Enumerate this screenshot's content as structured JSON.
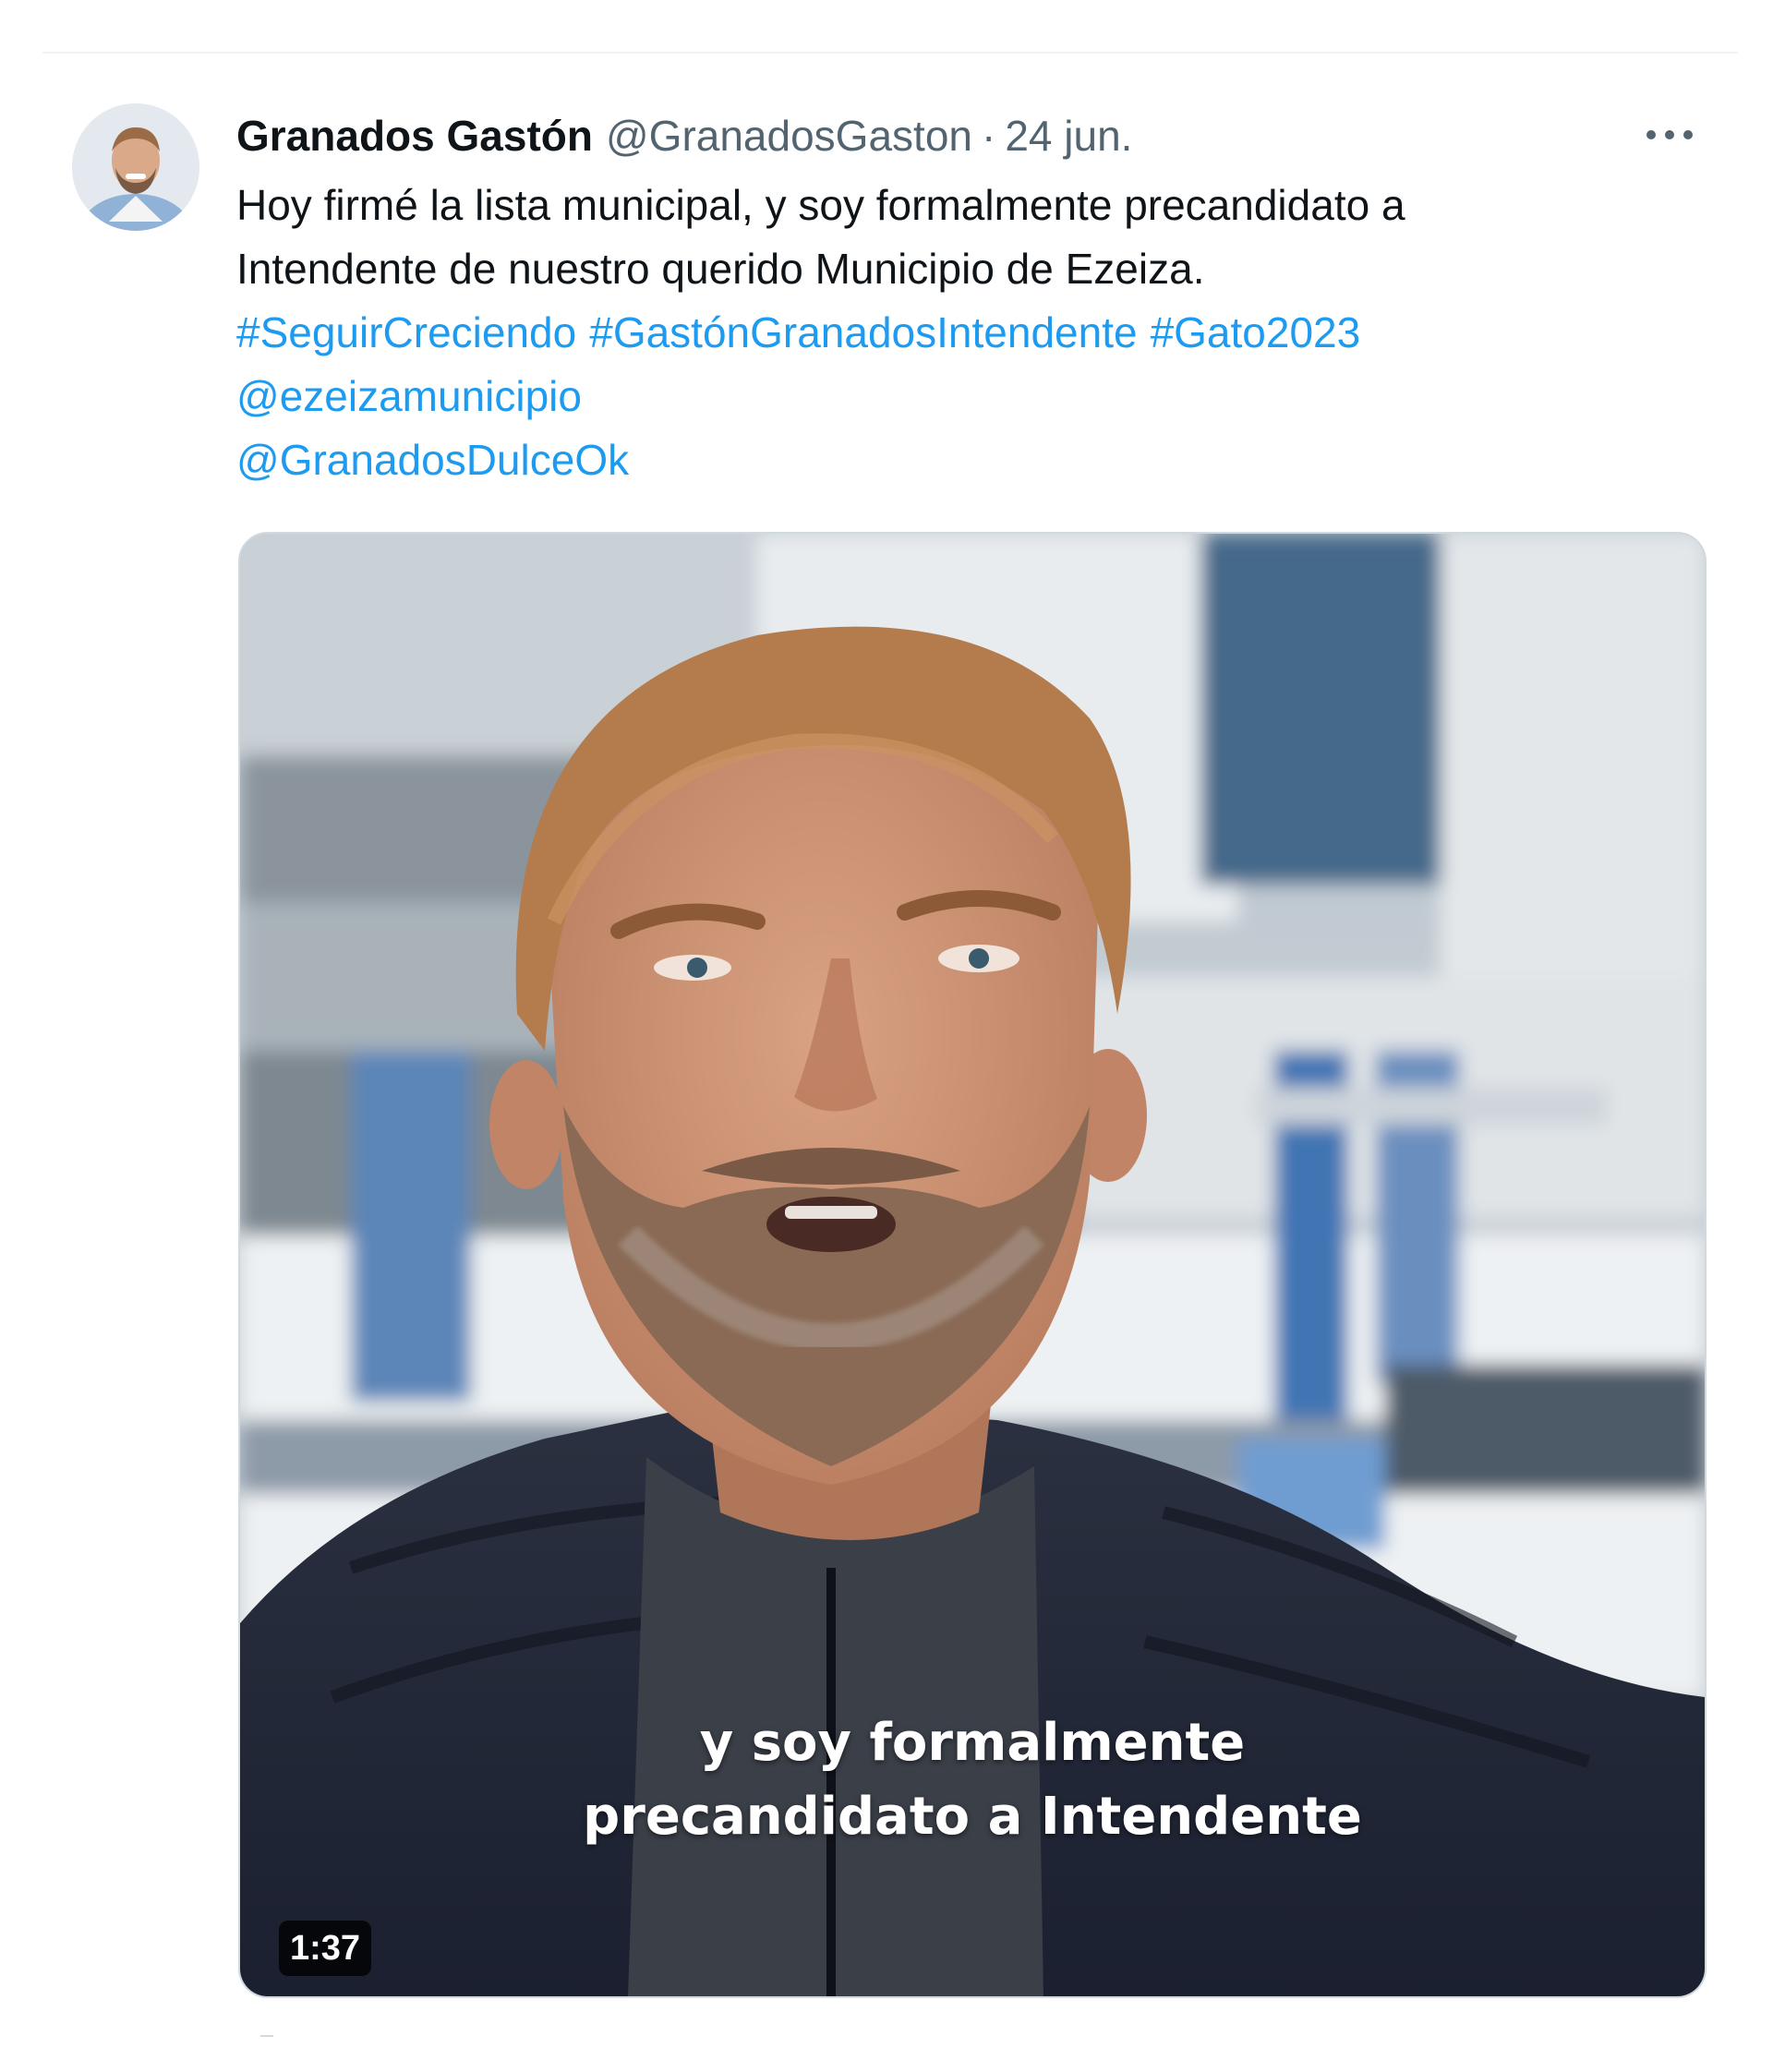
{
  "tweet": {
    "author": {
      "display_name": "Granados Gastón",
      "handle": "@GranadosGaston"
    },
    "separator": "·",
    "date": "24 jun.",
    "more_menu": "more-horizontal-icon",
    "text_lines": [
      "Hoy firmé la lista municipal, y soy formalmente precandidato a",
      "Intendente de nuestro querido Municipio de Ezeiza."
    ],
    "hashtags": [
      "#SeguirCreciendo",
      "#GastónGranadosIntendente",
      "#Gato2023"
    ],
    "mentions": [
      "@ezeizamunicipio",
      "@GranadosDulceOk"
    ],
    "media": {
      "type": "video",
      "caption_lines": [
        "y soy formalmente",
        "precandidato a Intendente"
      ],
      "duration": "1:37"
    }
  },
  "colors": {
    "text": "#0f1419",
    "secondary": "#536471",
    "link": "#1d9bf0",
    "divider": "#eff3f4"
  }
}
